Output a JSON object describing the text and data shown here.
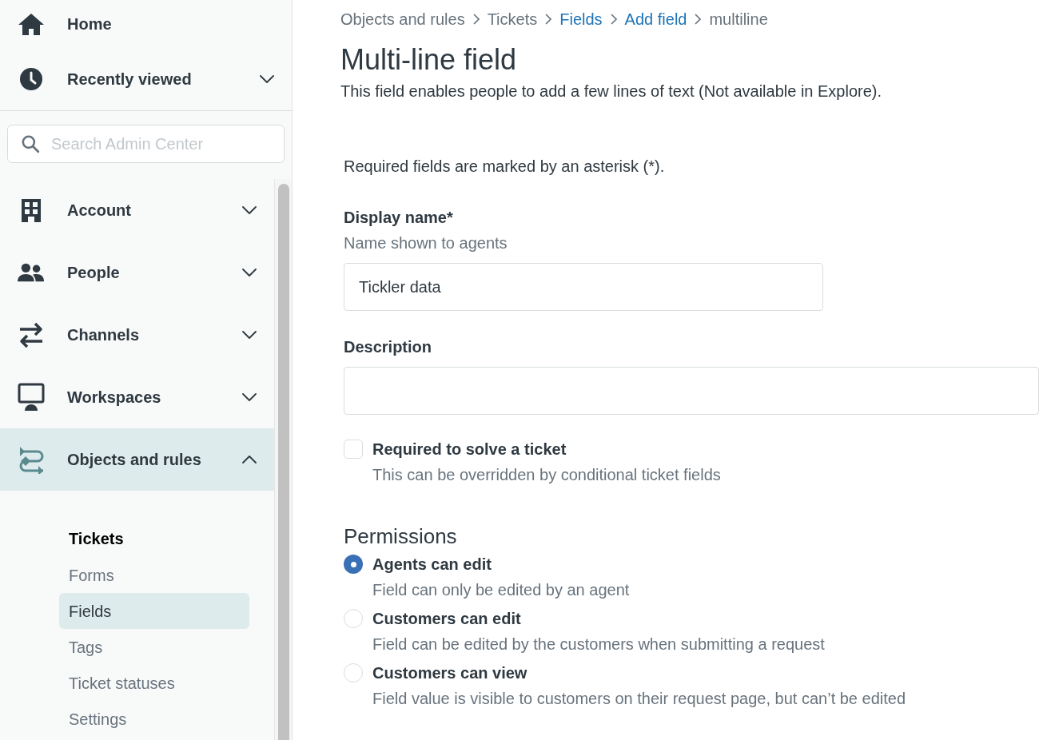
{
  "sidebar": {
    "home": {
      "label": "Home"
    },
    "recently_viewed": {
      "label": "Recently viewed",
      "expanded": false
    },
    "search": {
      "placeholder": "Search Admin Center"
    },
    "items": [
      {
        "label": "Account",
        "expanded": false,
        "selected": false
      },
      {
        "label": "People",
        "expanded": false,
        "selected": false
      },
      {
        "label": "Channels",
        "expanded": false,
        "selected": false
      },
      {
        "label": "Workspaces",
        "expanded": false,
        "selected": false
      },
      {
        "label": "Objects and rules",
        "expanded": true,
        "selected": true
      }
    ],
    "sub_heading": "Tickets",
    "sub_items": [
      {
        "label": "Forms",
        "selected": false
      },
      {
        "label": "Fields",
        "selected": true
      },
      {
        "label": "Tags",
        "selected": false
      },
      {
        "label": "Ticket statuses",
        "selected": false
      },
      {
        "label": "Settings",
        "selected": false
      }
    ]
  },
  "breadcrumb": [
    {
      "label": "Objects and rules",
      "link": false
    },
    {
      "label": "Tickets",
      "link": false
    },
    {
      "label": "Fields",
      "link": true
    },
    {
      "label": "Add field",
      "link": true
    },
    {
      "label": "multiline",
      "link": false
    }
  ],
  "title": "Multi-line field",
  "subtitle": "This field enables people to add a few lines of text (Not available in Explore).",
  "required_note": "Required fields are marked by an asterisk (*).",
  "display_name": {
    "label": "Display name*",
    "hint": "Name shown to agents",
    "value": "Tickler data"
  },
  "description": {
    "label": "Description"
  },
  "required_checkbox": {
    "label": "Required to solve a ticket",
    "hint": "This can be overridden by conditional ticket fields",
    "checked": false
  },
  "permissions": {
    "heading": "Permissions",
    "options": [
      {
        "label": "Agents can edit",
        "hint": "Field can only be edited by an agent",
        "selected": true
      },
      {
        "label": "Customers can edit",
        "hint": "Field can be edited by the customers when submitting a request",
        "selected": false
      },
      {
        "label": "Customers can view",
        "hint": "Field value is visible to customers on their request page, but can’t be edited",
        "selected": false
      }
    ]
  }
}
